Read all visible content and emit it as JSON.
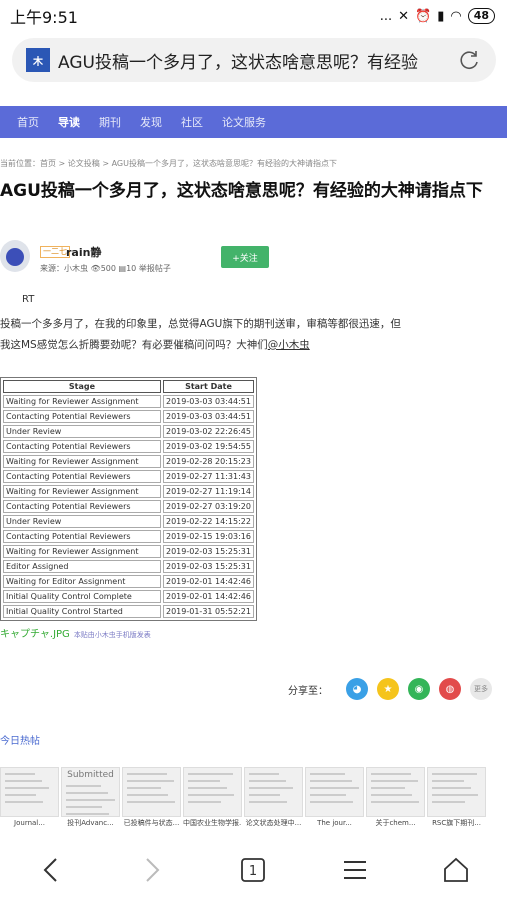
{
  "status": {
    "time": "上午9:51",
    "icons": "...",
    "battery": "48"
  },
  "url": {
    "text": "AGU投稿一个多月了，这状态啥意思呢？有经验"
  },
  "nav": [
    "首页",
    "导读",
    "期刊",
    "发现",
    "社区",
    "论文服务"
  ],
  "breadcrumb": "当前位置：首页 > 论文投稿 > AGU投稿一个多月了，这状态啥意思呢？有经验的大神请指点下",
  "post": {
    "title": "AGU投稿一个多月了，这状态啥意思呢？有经验的大神请指点下",
    "author_badge": "一二七",
    "author": "rain静",
    "source_label": "来源：小木虫",
    "views": "500",
    "comments": "10",
    "report": "举报帖子",
    "follow": "+关注",
    "rt": "RT",
    "body_line1": "投稿一个多多月了，在我的印象里，总觉得AGU旗下的期刊送审，审稿等都很迅速，但",
    "body_line2": "我这MS感觉怎么折腾要劲呢？有必要催稿问问吗？大神们",
    "mention": "@小木虫"
  },
  "table": {
    "headers": [
      "Stage",
      "Start Date"
    ],
    "rows": [
      [
        "Waiting for Reviewer Assignment",
        "2019-03-03 03:44:51"
      ],
      [
        "Contacting Potential Reviewers",
        "2019-03-03 03:44:51"
      ],
      [
        "Under Review",
        "2019-03-02 22:26:45"
      ],
      [
        "Contacting Potential Reviewers",
        "2019-03-02 19:54:55"
      ],
      [
        "Waiting for Reviewer Assignment",
        "2019-02-28 20:15:23"
      ],
      [
        "Contacting Potential Reviewers",
        "2019-02-27 11:31:43"
      ],
      [
        "Waiting for Reviewer Assignment",
        "2019-02-27 11:19:14"
      ],
      [
        "Contacting Potential Reviewers",
        "2019-02-27 03:19:20"
      ],
      [
        "Under Review",
        "2019-02-22 14:15:22"
      ],
      [
        "Contacting Potential Reviewers",
        "2019-02-15 19:03:16"
      ],
      [
        "Waiting for Reviewer Assignment",
        "2019-02-03 15:25:31"
      ],
      [
        "Editor Assigned",
        "2019-02-03 15:25:31"
      ],
      [
        "Waiting for Editor Assignment",
        "2019-02-01 14:42:46"
      ],
      [
        "Initial Quality Control Complete",
        "2019-02-01 14:42:46"
      ],
      [
        "Initial Quality Control Started",
        "2019-01-31 05:52:21"
      ]
    ]
  },
  "attachment": {
    "name": "キャプチャ.JPG",
    "note": "本贴由小木虫手机版发表"
  },
  "share": {
    "label": "分享至：",
    "more": "更多"
  },
  "today_hot": "今日热帖",
  "thumbs": [
    {
      "cap": "Journal..."
    },
    {
      "cap": "投刊Advanc..."
    },
    {
      "cap": "已投稿件与状态..."
    },
    {
      "cap": "中国农业生物学报..."
    },
    {
      "cap": "论文状态处理中..."
    },
    {
      "cap": "The jour..."
    },
    {
      "cap": "关于chem..."
    },
    {
      "cap": "RSC旗下期刊..."
    }
  ],
  "thumb2_top": "Submitted",
  "bottom": {
    "tabs_count": "1"
  },
  "colors": {
    "nav_bg": "#5b6bd8",
    "follow": "#43b36a",
    "link": "#4a6ad0"
  }
}
